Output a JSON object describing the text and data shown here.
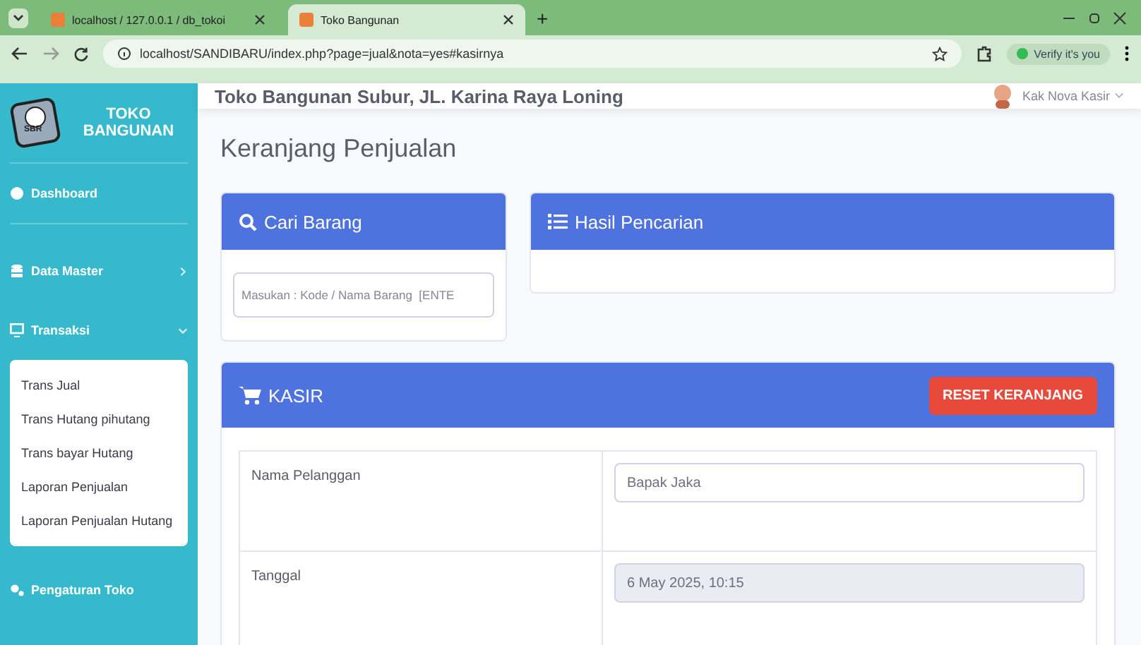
{
  "browser": {
    "tabs": [
      {
        "label": "localhost / 127.0.0.1 / db_tokoi",
        "selected": false
      },
      {
        "label": "Toko Bangunan",
        "selected": true
      }
    ],
    "new_tab": "+",
    "address": "localhost/SANDIBARU/index.php?page=jual&nota=yes#kasirnya",
    "profile_button": "Verify it's you"
  },
  "sidebar": {
    "brand": [
      "TOKO",
      "BANGUNAN"
    ],
    "logo_text": "SBR",
    "items": [
      {
        "label": "Dashboard"
      },
      {
        "label": "Data Master",
        "expanded": false,
        "has_children": true
      },
      {
        "label": "Transaksi",
        "expanded": true,
        "has_children": true,
        "children": [
          {
            "label": "Trans Jual"
          },
          {
            "label": "Trans Hutang pihutang"
          },
          {
            "label": "Trans bayar Hutang"
          },
          {
            "label": "Laporan Penjualan"
          },
          {
            "label": "Laporan Penjualan Hutang"
          }
        ]
      },
      {
        "label": "Pengaturan Toko"
      }
    ]
  },
  "topbar": {
    "store": "Toko Bangunan Subur, JL. Karina Raya Loning",
    "user": "Kak Nova Kasir"
  },
  "page_title": "Keranjang Penjualan",
  "search_card": {
    "title": "Cari Barang",
    "placeholder": "Masukan : Kode / Nama Barang  [ENTE"
  },
  "results_card": {
    "title": "Hasil Pencarian"
  },
  "kasir_card": {
    "title": "KASIR",
    "reset_button": "RESET KERANJANG",
    "rows": [
      {
        "label": "Nama Pelanggan",
        "value": "Bapak Jaka",
        "disabled": false
      },
      {
        "label": "Tanggal",
        "value": "6 May 2025, 10:15",
        "disabled": true
      }
    ]
  }
}
